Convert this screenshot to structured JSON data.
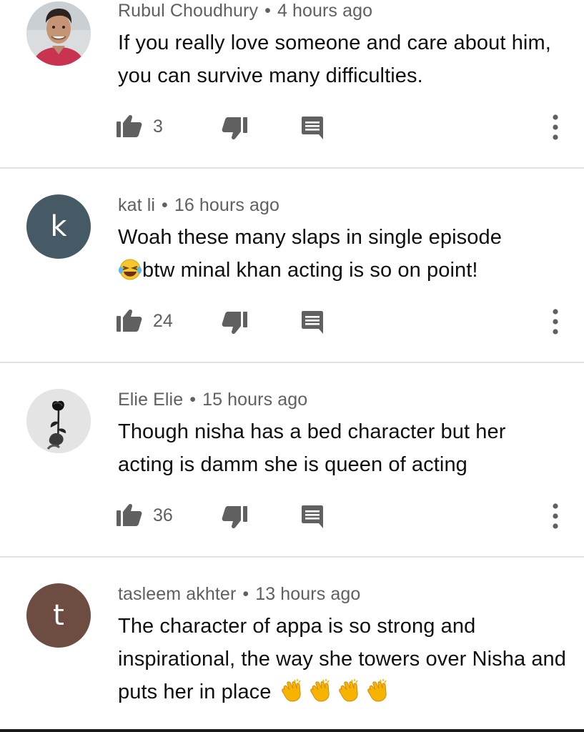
{
  "comments": [
    {
      "author": "Rubul Choudhury",
      "time": "4 hours ago",
      "text": "If you really love someone and care about him, you can survive many difficulties.",
      "likes": "3",
      "avatar": "photo"
    },
    {
      "author": "kat li",
      "time": "16 hours ago",
      "text_emoji": "😂",
      "text_after": "btw minal khan acting is so on point!",
      "text_before": "Woah these many slaps in single episode",
      "likes": "24",
      "avatar_letter": "k",
      "avatar_color": "#455a64"
    },
    {
      "author": "Elie Elie",
      "time": "15 hours ago",
      "text": "Though nisha has a bed character but her acting is damm she is queen of acting",
      "likes": "36",
      "avatar": "rose-photo"
    },
    {
      "author": "tasleem akhter",
      "time": "13 hours ago",
      "text": "The character of appa is so strong and inspirational, the way she towers over Nisha and puts her in place",
      "text_emoji": "👏👏👏👏",
      "avatar_letter": "t",
      "avatar_color": "#6d4c41"
    }
  ],
  "separator": "•",
  "icons": {
    "like": "thumb-up-icon",
    "dislike": "thumb-down-icon",
    "reply": "reply-icon",
    "more": "more-vertical-icon"
  },
  "colors": {
    "icon": "#606060",
    "meta_text": "#606060",
    "body_text": "#0f0f0f",
    "divider": "#e2e2e2"
  }
}
